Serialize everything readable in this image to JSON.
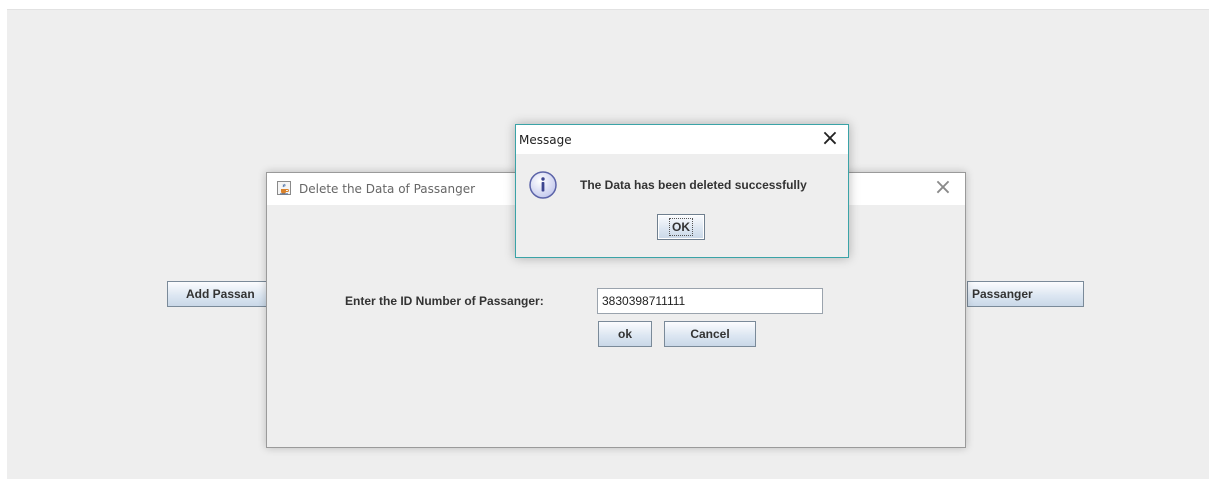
{
  "background": {
    "left_button_label": "Add Passan",
    "right_button_label": "Passanger"
  },
  "delete_dialog": {
    "title": "Delete the Data of Passanger",
    "close_symbol": "×",
    "id_label": "Enter the ID Number of Passanger:",
    "id_value": "3830398711111",
    "ok_label": "ok",
    "cancel_label": "Cancel",
    "icon": "java-cup-icon"
  },
  "message_dialog": {
    "title": "Message",
    "close_symbol": "×",
    "message": "The Data has been deleted successfully",
    "ok_label": "OK",
    "icon": "info-icon"
  },
  "colors": {
    "panel_bg": "#eeeeee",
    "accent_border": "#3aa3a7",
    "button_border": "#7a8a99"
  }
}
